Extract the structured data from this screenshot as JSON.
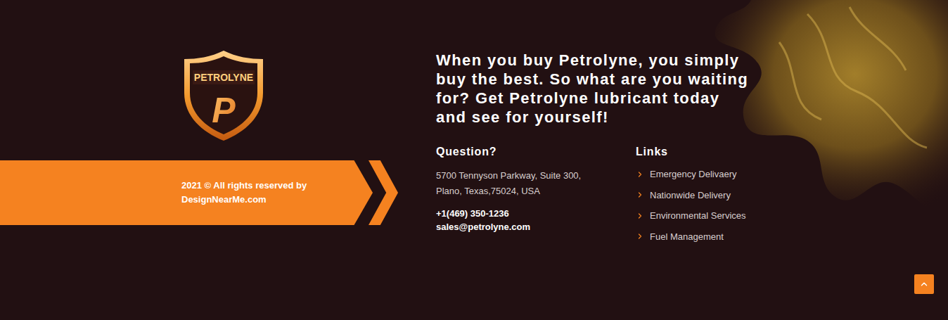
{
  "logo": {
    "name": "PETROLYNE",
    "mark": "P"
  },
  "copyright": {
    "lines": [
      "2021 © All rights reserved by",
      "DesignNearMe.com"
    ]
  },
  "headline": "When you buy Petrolyne, you simply buy the best. So what are you waiting for? Get Petrolyne lubricant today and see for yourself!",
  "contact": {
    "title": "Question?",
    "address": [
      "5700 Tennyson Parkway, Suite 300,",
      "Plano, Texas,75024, USA"
    ],
    "phone": "+1(469) 350-1236",
    "email": "sales@petrolyne.com"
  },
  "links": {
    "title": "Links",
    "items": [
      "Emergency Delivaery",
      "Nationwide Delivery",
      "Environmental Services",
      "Fuel Management"
    ]
  }
}
